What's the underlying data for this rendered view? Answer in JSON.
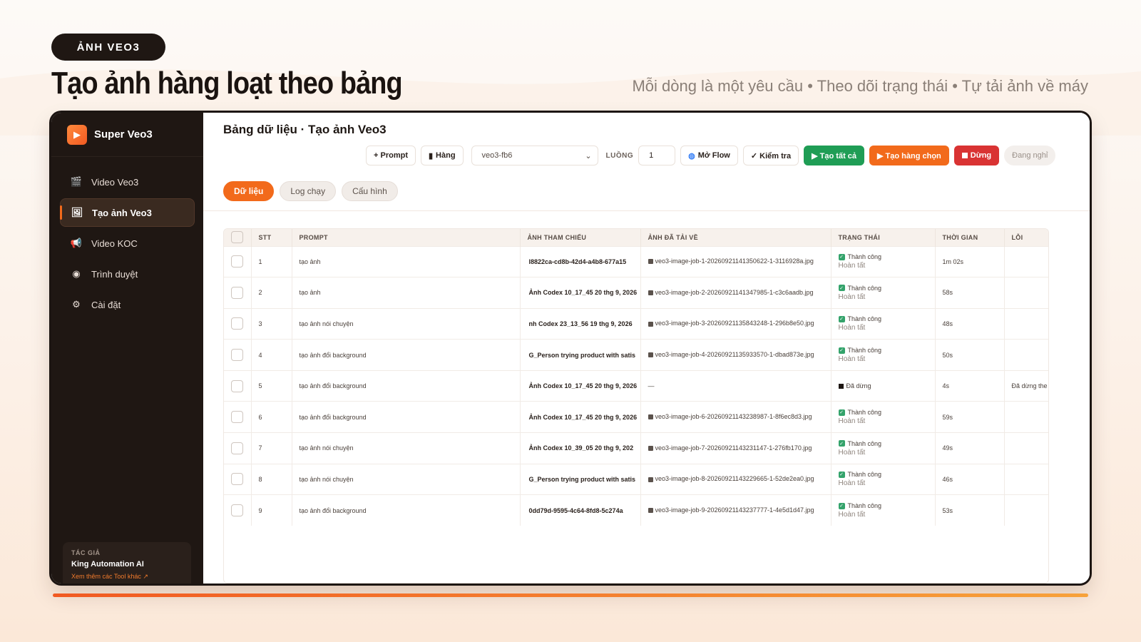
{
  "hero": {
    "tag": "ẢNH VEO3",
    "title": "Tạo ảnh hàng loạt theo bảng",
    "subtitle": "Mỗi dòng là một yêu cầu • Theo dõi trạng thái • Tự tải ảnh về máy"
  },
  "sidebar": {
    "brand": "Super Veo3",
    "items": [
      {
        "label": "Video Veo3",
        "icon": "clapperboard-icon"
      },
      {
        "label": "Tạo ảnh Veo3",
        "icon": "image-icon",
        "active": true
      },
      {
        "label": "Video KOC",
        "icon": "megaphone-icon"
      },
      {
        "label": "Trình duyệt",
        "icon": "globe-icon"
      },
      {
        "label": "Cài đặt",
        "icon": "gear-icon"
      }
    ],
    "author": {
      "label": "TÁC GIẢ",
      "name": "King Automation AI",
      "link": "Xem thêm các Tool khác ↗"
    }
  },
  "main": {
    "title": "Bảng dữ liệu · Tạo ảnh Veo3",
    "toolbar": {
      "add_prompt": "+ Prompt",
      "row": "Hàng",
      "select_value": "veo3-fb6",
      "threads_label": "LUỒNG",
      "threads_value": "1",
      "open_flow": "Mở Flow",
      "check": "✓ Kiểm tra",
      "create_all": "▶ Tạo tất cả",
      "create_selected": "▶ Tạo hàng chọn",
      "stop": "Dừng",
      "status": "Đang nghỉ"
    },
    "tabs": [
      "Dữ liệu",
      "Log chạy",
      "Cấu hình"
    ],
    "columns": [
      "STT",
      "PROMPT",
      "ẢNH THAM CHIẾU",
      "ẢNH ĐÃ TẢI VỀ",
      "TRẠNG THÁI",
      "THỜI GIAN",
      "LỖI"
    ],
    "rows": [
      {
        "stt": "1",
        "prompt": "tạo ảnh",
        "ref": "l8822ca-cd8b-42d4-a4b8-677a15",
        "file": "veo3-image-job-1-20260921141350622-1-3116928a.jpg",
        "status": "Thành công",
        "status2": "Hoàn tất",
        "ok": true,
        "time": "1m 02s",
        "error": ""
      },
      {
        "stt": "2",
        "prompt": "tạo ảnh",
        "ref": "Ảnh Codex 10_17_45 20 thg 9, 2026",
        "file": "veo3-image-job-2-20260921141347985-1-c3c6aadb.jpg",
        "status": "Thành công",
        "status2": "Hoàn tất",
        "ok": true,
        "time": "58s",
        "error": ""
      },
      {
        "stt": "3",
        "prompt": "tạo ảnh nói chuyện",
        "ref": "nh Codex 23_13_56 19 thg 9, 2026",
        "file": "veo3-image-job-3-20260921135843248-1-296b8e50.jpg",
        "status": "Thành công",
        "status2": "Hoàn tất",
        "ok": true,
        "time": "48s",
        "error": ""
      },
      {
        "stt": "4",
        "prompt": "tạo ảnh đổi background",
        "ref": "G_Person trying product with satis",
        "file": "veo3-image-job-4-20260921135933570-1-dbad873e.jpg",
        "status": "Thành công",
        "status2": "Hoàn tất",
        "ok": true,
        "time": "50s",
        "error": ""
      },
      {
        "stt": "5",
        "prompt": "tạo ảnh đổi background",
        "ref": "Ảnh Codex 10_17_45 20 thg 9, 2026",
        "file": "—",
        "status": "Đã dừng",
        "status2": "",
        "ok": false,
        "time": "4s",
        "error": "Đã dừng the"
      },
      {
        "stt": "6",
        "prompt": "tạo ảnh đổi background",
        "ref": "Ảnh Codex 10_17_45 20 thg 9, 2026",
        "file": "veo3-image-job-6-20260921143238987-1-8f6ec8d3.jpg",
        "status": "Thành công",
        "status2": "Hoàn tất",
        "ok": true,
        "time": "59s",
        "error": ""
      },
      {
        "stt": "7",
        "prompt": "tạo ảnh nói chuyện",
        "ref": "Ảnh Codex 10_39_05 20 thg 9, 202",
        "file": "veo3-image-job-7-20260921143231147-1-276fb170.jpg",
        "status": "Thành công",
        "status2": "Hoàn tất",
        "ok": true,
        "time": "49s",
        "error": ""
      },
      {
        "stt": "8",
        "prompt": "tạo ảnh nói chuyện",
        "ref": "G_Person trying product with satis",
        "file": "veo3-image-job-8-20260921143229665-1-52de2ea0.jpg",
        "status": "Thành công",
        "status2": "Hoàn tất",
        "ok": true,
        "time": "46s",
        "error": ""
      },
      {
        "stt": "9",
        "prompt": "tạo ảnh đổi background",
        "ref": "0dd79d-9595-4c64-8fd8-5c274a",
        "file": "veo3-image-job-9-20260921143237777-1-4e5d1d47.jpg",
        "status": "Thành công",
        "status2": "Hoàn tất",
        "ok": true,
        "time": "53s",
        "error": ""
      }
    ]
  },
  "colors": {
    "accent": "#f26a1b",
    "sidebar_bg": "#1f1713",
    "success": "#1f9d55",
    "danger": "#d93333"
  }
}
